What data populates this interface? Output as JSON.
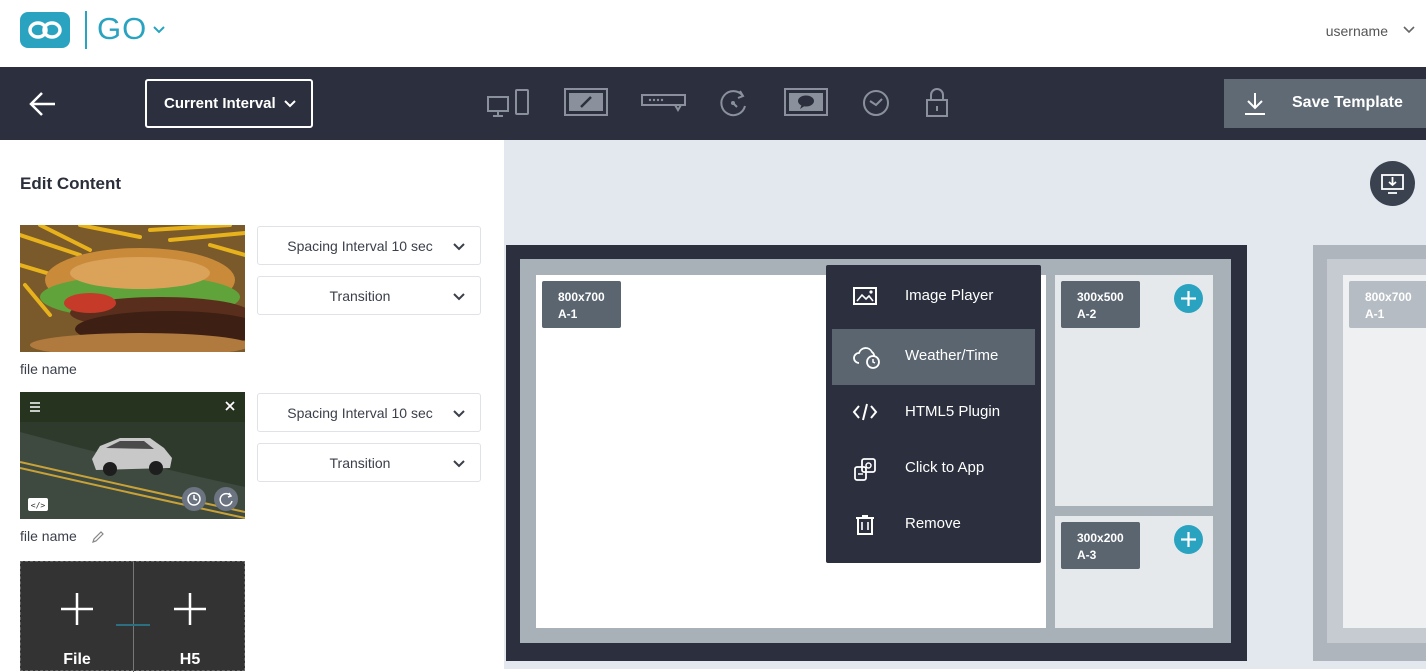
{
  "header": {
    "brand": "GO",
    "username": "username",
    "colors": {
      "brand": "#2aa3c1",
      "toolbar": "#2c303e"
    }
  },
  "toolbar": {
    "interval_label": "Current Interval",
    "save_label": "Save Template",
    "icons": [
      "devices-icon",
      "edit-frame-icon",
      "ticker-icon",
      "rotate-icon",
      "comment-frame-icon",
      "clock-icon",
      "lock-icon"
    ]
  },
  "left_panel": {
    "title": "Edit Content",
    "items": [
      {
        "spacing": "Spacing Interval 10 sec",
        "transition": "Transition",
        "file_name": "file name"
      },
      {
        "spacing": "Spacing Interval 10 sec",
        "transition": "Transition",
        "file_name": "file name"
      }
    ],
    "add_tiles": [
      {
        "label": "File"
      },
      {
        "label": "H5"
      }
    ]
  },
  "canvas": {
    "zones": [
      {
        "size": "800x700",
        "id": "A-1"
      },
      {
        "size": "300x500",
        "id": "A-2"
      },
      {
        "size": "300x200",
        "id": "A-3"
      }
    ],
    "preview_zone": {
      "size": "800x700",
      "id": "A-1"
    }
  },
  "context_menu": {
    "items": [
      {
        "label": "Image Player",
        "icon": "image-icon"
      },
      {
        "label": "Weather/Time",
        "icon": "weather-time-icon",
        "active": true
      },
      {
        "label": "HTML5 Plugin",
        "icon": "code-icon"
      },
      {
        "label": "Click to App",
        "icon": "click-app-icon"
      },
      {
        "label": "Remove",
        "icon": "trash-icon"
      }
    ]
  }
}
